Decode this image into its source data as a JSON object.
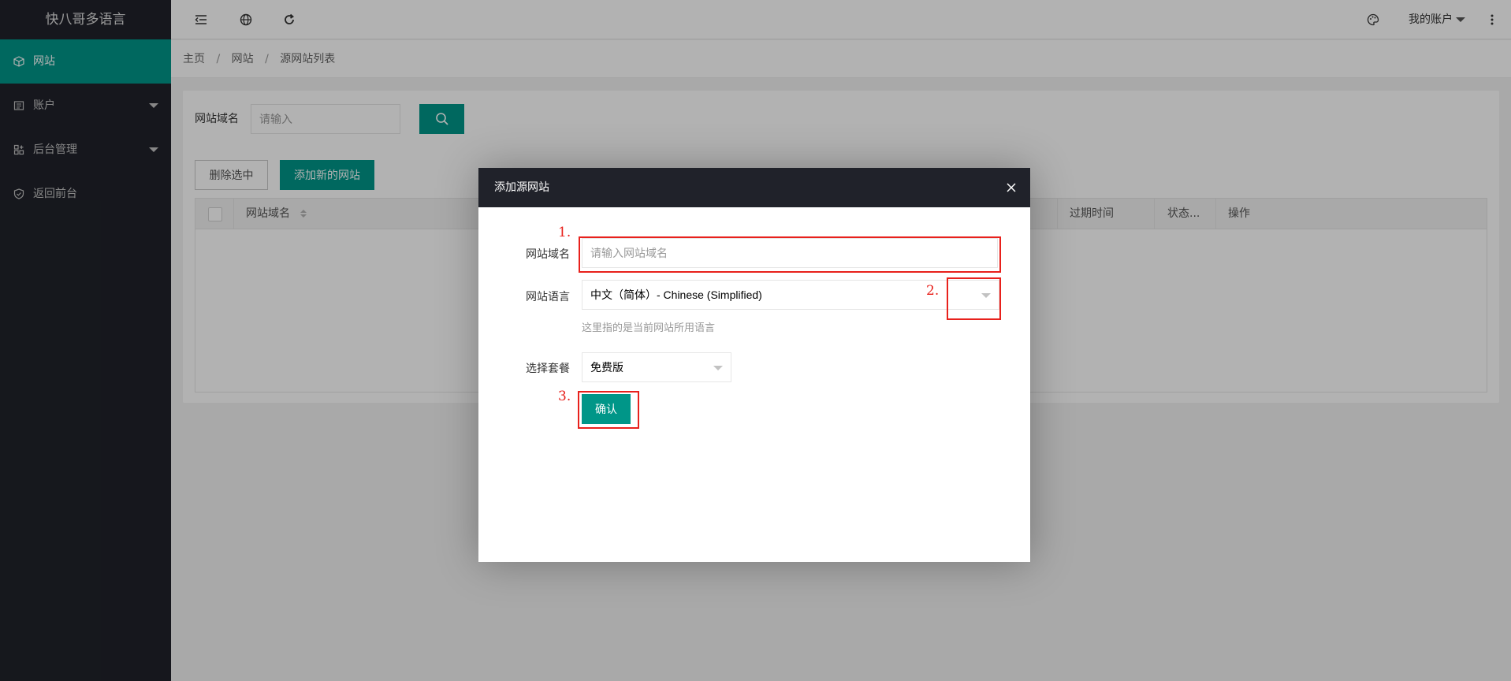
{
  "sidebar": {
    "logo": "快八哥多语言",
    "items": [
      {
        "label": "网站",
        "icon": "cube-icon",
        "active": true
      },
      {
        "label": "账户",
        "icon": "account-icon",
        "has_submenu": true
      },
      {
        "label": "后台管理",
        "icon": "admin-icon",
        "has_submenu": true
      },
      {
        "label": "返回前台",
        "icon": "shield-icon"
      }
    ]
  },
  "header": {
    "account_label": "我的账户",
    "icons": [
      "menu-fold-icon",
      "globe-icon",
      "refresh-icon",
      "palette-icon",
      "more-vertical-icon"
    ]
  },
  "breadcrumb": {
    "items": [
      "主页",
      "网站",
      "源网站列表"
    ],
    "separator": "/"
  },
  "search": {
    "label": "网站域名",
    "placeholder": "请输入"
  },
  "toolbar": {
    "delete_label": "删除选中",
    "add_label": "添加新的网站"
  },
  "table": {
    "columns": [
      "网站域名",
      "过期时间",
      "状态...",
      "操作"
    ],
    "rows": []
  },
  "modal": {
    "title": "添加源网站",
    "domain_label": "网站域名",
    "domain_placeholder": "请输入网站域名",
    "language_label": "网站语言",
    "language_value": "中文（简体）- Chinese (Simplified)",
    "language_hint": "这里指的是当前网站所用语言",
    "plan_label": "选择套餐",
    "plan_value": "免费版",
    "confirm_label": "确认"
  },
  "annotations": [
    "1.",
    "2.",
    "3."
  ],
  "colors": {
    "accent": "#009688",
    "sidebar_bg": "#20222a",
    "annotation": "#e8211c"
  }
}
